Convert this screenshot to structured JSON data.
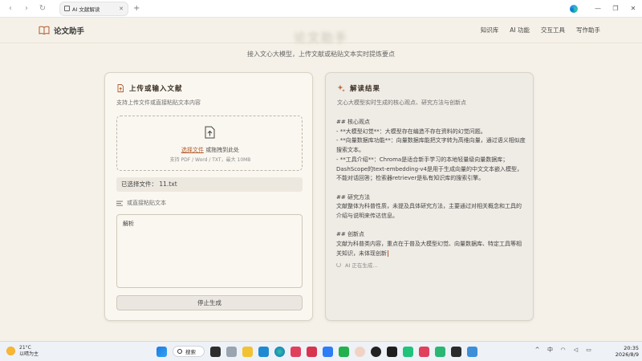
{
  "browser": {
    "tab_title": "AI 文献解读",
    "tab_close": "✕",
    "new_tab": "+",
    "back_glyph": "‹",
    "forward_glyph": "›",
    "reload_glyph": "↻",
    "minimize": "—",
    "maximize": "❐",
    "close": "✕"
  },
  "header": {
    "brand": "论文助手",
    "nav": [
      "知识库",
      "AI 功能",
      "交互工具",
      "写作助手"
    ]
  },
  "hero": {
    "title": "论文助手",
    "subtitle": "接入文心大模型，上传文献或粘贴文本实时提炼要点"
  },
  "left_panel": {
    "title": "上传或输入文献",
    "description": "支持上传文件或直接粘贴文本内容",
    "dropzone": {
      "link": "选择文件",
      "text": " 或拖拽到此处",
      "hint": "支持 PDF / Word / TXT，最大 10MB"
    },
    "selected_file": "已选择文件： 11.txt",
    "paste_label": "或直接粘贴文本",
    "textarea_value": "解析",
    "stop_button": "停止生成"
  },
  "right_panel": {
    "title": "解读结果",
    "description": "文心大模型实时生成的核心观点、研究方法与创新点",
    "output": "## 核心观点\n- **大模型幻觉**：大模型存在编造不存在资料的幻觉问题。\n- **向量数据库功能**：向量数据库能把文字转为高维向量，通过语义相似度搜索文本。\n- **工具介绍**：Chroma是适合新手学习的本地轻量级向量数据库；DashScope的text-embedding-v4是用于生成向量的中文文本嵌入模型，不能对话回答；检索器retriever是私有知识库的搜索引擎。\n\n## 研究方法\n文献整体为科普性质，未提及具体研究方法，主要通过对相关概念和工具的介绍与说明来传达信息。\n\n## 创新点\n文献为科普类内容，重点在于普及大模型幻觉、向量数据库、特定工具等相关知识，未体现创新",
    "status": "AI 正在生成..."
  },
  "taskbar": {
    "temperature": "21°C",
    "weather": "以晴为主",
    "search": "搜索",
    "time": "20:35",
    "date": "2026/8/9",
    "lang": "中"
  },
  "colors": {
    "accent": "#b25c2e",
    "background": "#f5f1e8"
  }
}
